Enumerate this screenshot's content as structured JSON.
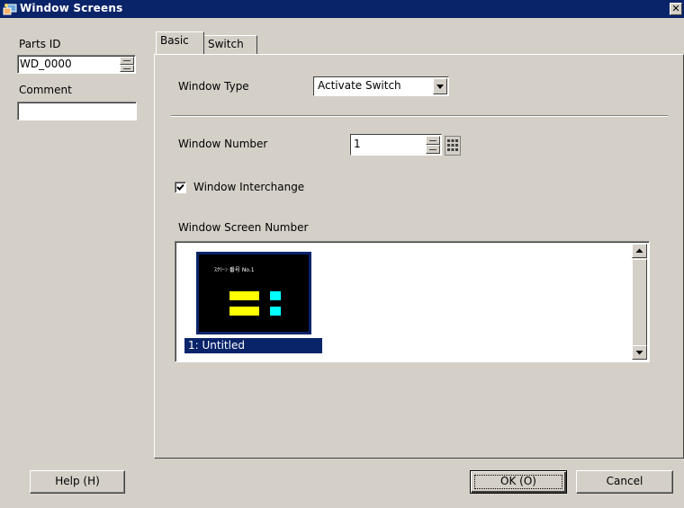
{
  "window": {
    "title": "Window Screens",
    "close_symbol": "✕"
  },
  "left": {
    "parts_id_label": "Parts ID",
    "parts_id_value": "WD_0000",
    "comment_label": "Comment",
    "comment_value": ""
  },
  "tabs": [
    {
      "label": "Basic",
      "active": true
    },
    {
      "label": "Switch",
      "active": false
    }
  ],
  "basic": {
    "window_type_label": "Window Type",
    "window_type_value": "Activate Switch",
    "window_number_label": "Window Number",
    "window_number_value": "1",
    "interchange_label": "Window Interchange",
    "interchange_checked": true,
    "screen_number_label": "Window Screen Number",
    "screens": [
      {
        "caption": "1: Untitled",
        "preview_text": "ｽｸﾘｰﾝ 番号 No.1",
        "selected": true
      }
    ]
  },
  "buttons": {
    "help_label": "Help (H)",
    "ok_label": "OK (O)",
    "cancel_label": "Cancel"
  },
  "colors": {
    "titlebar": "#0a246a",
    "face": "#d4d0c8",
    "selection": "#0a246a",
    "preview_yellow": "#ffff00",
    "preview_cyan": "#00ffff"
  }
}
